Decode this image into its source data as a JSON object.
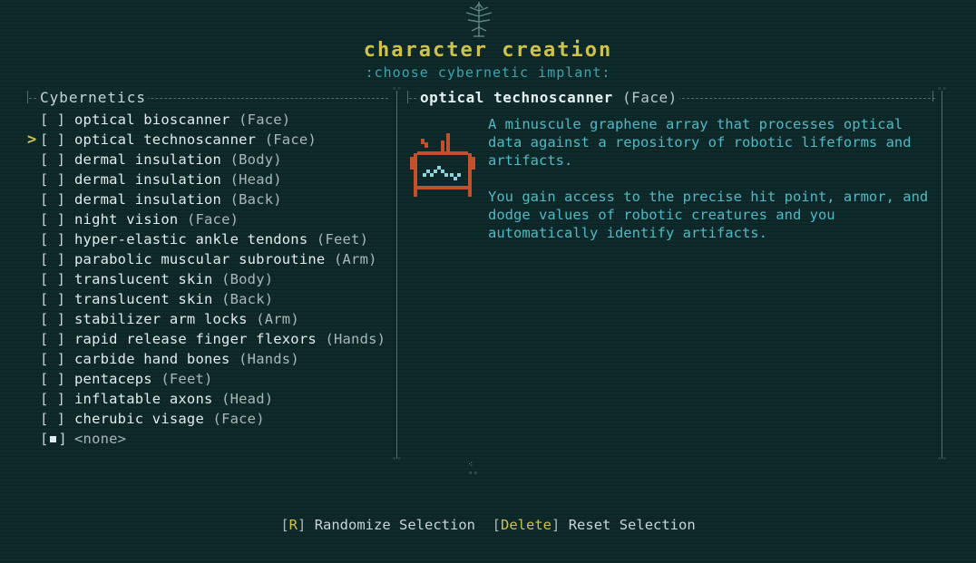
{
  "header": {
    "title": "character creation",
    "subtitle": ":choose cybernetic implant:"
  },
  "left_panel": {
    "title": "Cybernetics",
    "items": [
      {
        "name": "optical bioscanner",
        "slot": "(Face)",
        "box": "[ ]",
        "highlighted": false
      },
      {
        "name": "optical technoscanner",
        "slot": "(Face)",
        "box": "[ ]",
        "highlighted": true
      },
      {
        "name": "dermal insulation",
        "slot": "(Body)",
        "box": "[ ]",
        "highlighted": false
      },
      {
        "name": "dermal insulation",
        "slot": "(Head)",
        "box": "[ ]",
        "highlighted": false
      },
      {
        "name": "dermal insulation",
        "slot": "(Back)",
        "box": "[ ]",
        "highlighted": false
      },
      {
        "name": "night vision",
        "slot": "(Face)",
        "box": "[ ]",
        "highlighted": false
      },
      {
        "name": "hyper-elastic ankle tendons",
        "slot": "(Feet)",
        "box": "[ ]",
        "highlighted": false
      },
      {
        "name": "parabolic muscular subroutine",
        "slot": "(Arm)",
        "box": "[ ]",
        "highlighted": false
      },
      {
        "name": "translucent skin",
        "slot": "(Body)",
        "box": "[ ]",
        "highlighted": false
      },
      {
        "name": "translucent skin",
        "slot": "(Back)",
        "box": "[ ]",
        "highlighted": false
      },
      {
        "name": "stabilizer arm locks",
        "slot": "(Arm)",
        "box": "[ ]",
        "highlighted": false
      },
      {
        "name": "rapid release finger flexors",
        "slot": "(Hands)",
        "box": "[ ]",
        "highlighted": false
      },
      {
        "name": "carbide hand bones",
        "slot": "(Hands)",
        "box": "[ ]",
        "highlighted": false
      },
      {
        "name": "pentaceps",
        "slot": "(Feet)",
        "box": "[ ]",
        "highlighted": false
      },
      {
        "name": "inflatable axons",
        "slot": "(Head)",
        "box": "[ ]",
        "highlighted": false
      },
      {
        "name": "cherubic visage",
        "slot": "(Face)",
        "box": "[ ]",
        "highlighted": false
      }
    ],
    "none_item": {
      "name": "<none>",
      "selected": true
    },
    "cursor_glyph": ">"
  },
  "right_panel": {
    "title_name": "optical technoscanner",
    "title_slot": "(Face)",
    "description": [
      "A minuscule graphene array that processes optical data against a repository of robotic lifeforms and artifacts.",
      "You gain access to the precise hit point, armor, and dodge values of robotic creatures and you automatically identify artifacts."
    ],
    "icon": "optical-technoscanner-icon"
  },
  "footer": {
    "randomize_key": "R",
    "randomize_label": "Randomize Selection",
    "reset_key": "Delete",
    "reset_label": "Reset Selection"
  },
  "colors": {
    "background": "#0f2a2b",
    "accent_yellow": "#cfc24a",
    "accent_cyan": "#4fb9c4",
    "text": "#c6d6d4",
    "icon_orange": "#c2502b",
    "icon_cyan": "#8fd3dc"
  }
}
